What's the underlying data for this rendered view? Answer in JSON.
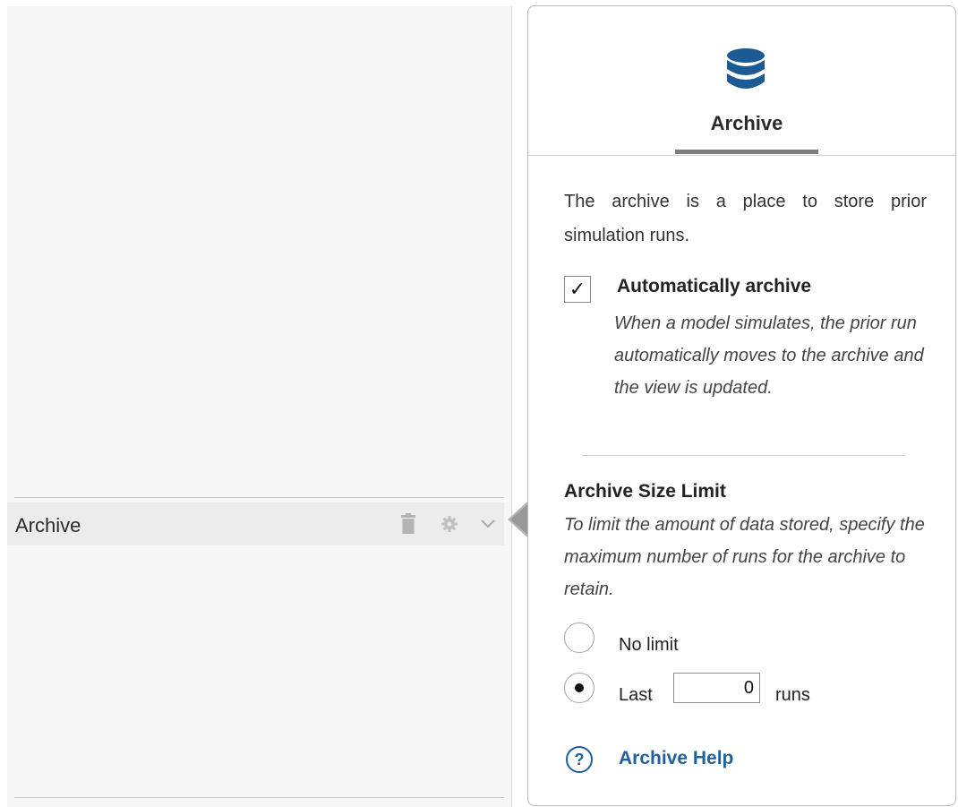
{
  "left_panel": {
    "row_label": "Archive",
    "row_icons": [
      "trash-icon",
      "gear-icon",
      "chevron-down-icon"
    ]
  },
  "panel": {
    "tab": {
      "label": "Archive",
      "icon": "database-icon"
    },
    "intro": "The archive is a place to store prior simulation runs.",
    "auto_archive": {
      "checked": true,
      "title": "Automatically archive",
      "description": "When a model simulates, the prior run automatically moves to the archive and the view is updated."
    },
    "size_limit": {
      "title": "Archive Size Limit",
      "description": "To limit the amount of data stored, specify the maximum number of runs for the archive to retain.",
      "no_limit_label": "No limit",
      "last_label": "Last",
      "last_value": "0",
      "runs_label": "runs",
      "selected": "last"
    },
    "help": {
      "label": "Archive Help",
      "icon": "question-circle-icon"
    }
  },
  "colors": {
    "accent_blue": "#1f5f9e",
    "tab_underline": "#7d7d7d"
  }
}
